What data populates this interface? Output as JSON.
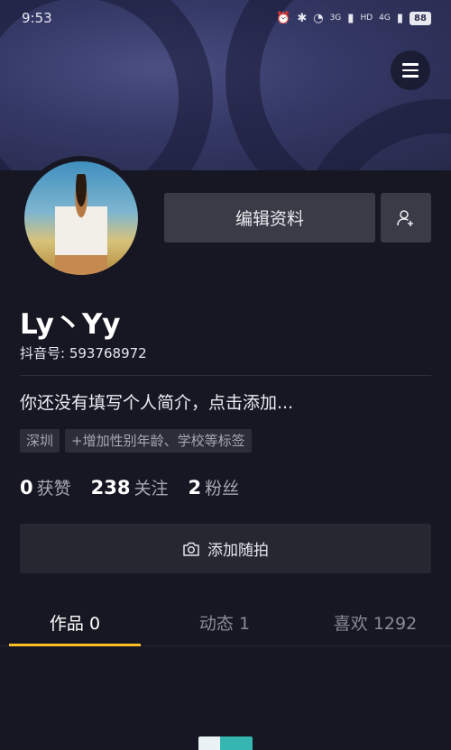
{
  "status_bar": {
    "time": "9:53",
    "network_1": "3G",
    "network_2": "4G",
    "hd": "HD",
    "battery": "88"
  },
  "profile": {
    "edit_label": "编辑资料",
    "username": "Ly丶Yy",
    "douyin_id": "抖音号: 593768972",
    "bio": "你还没有填写个人简介，点击添加...",
    "tags": [
      "深圳",
      "+增加性别年龄、学校等标签"
    ]
  },
  "stats": [
    {
      "value": "0",
      "label": "获赞"
    },
    {
      "value": "238",
      "label": "关注"
    },
    {
      "value": "2",
      "label": "粉丝"
    }
  ],
  "random_shot_label": "添加随拍",
  "tabs": [
    {
      "label": "作品 0"
    },
    {
      "label": "动态 1"
    },
    {
      "label": "喜欢 1292"
    }
  ],
  "colors": {
    "background": "#161722",
    "accent": "#fcbf24",
    "button": "#393b46"
  }
}
